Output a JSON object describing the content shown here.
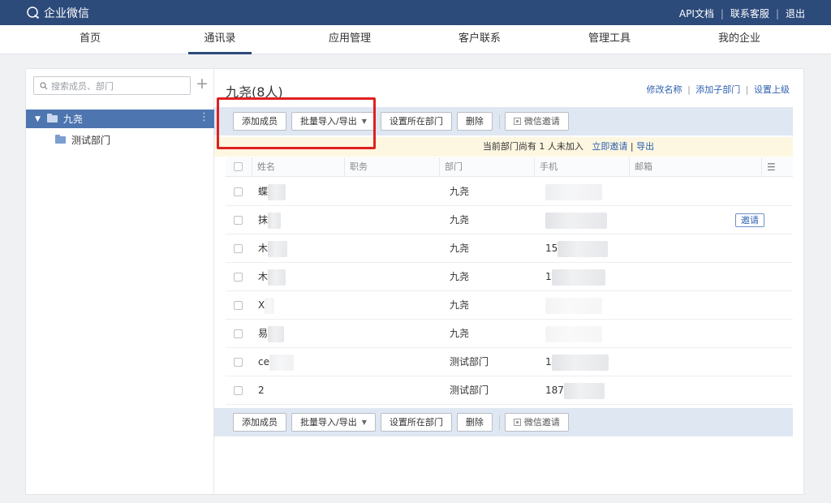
{
  "topbar": {
    "brand": "企业微信",
    "links": [
      "API文档",
      "联系客服",
      "退出"
    ],
    "separator": "|"
  },
  "nav": {
    "items": [
      "首页",
      "通讯录",
      "应用管理",
      "客户联系",
      "管理工具",
      "我的企业"
    ],
    "active_index": 1
  },
  "sidebar": {
    "search_placeholder": "搜索成员、部门",
    "add_icon": "plus-icon",
    "tree": {
      "root_label": "九尧",
      "menu_icon": "⋮",
      "children": [
        "测试部门"
      ]
    }
  },
  "main": {
    "title": "九尧(8人)",
    "header_links": [
      "修改名称",
      "添加子部门",
      "设置上级"
    ],
    "link_sep": "|",
    "toolbar": {
      "add_member": "添加成员",
      "batch": "批量导入/导出",
      "set_dept": "设置所在部门",
      "delete": "删除",
      "wechat_invite": "微信邀请"
    },
    "notice": {
      "text": "当前部门尚有 1 人未加入",
      "link_invite": "立即邀请",
      "sep": "|",
      "link_export": "导出"
    },
    "columns": [
      "姓名",
      "职务",
      "部门",
      "手机",
      "邮箱"
    ],
    "columns_menu_icon": "☰",
    "invite_label": "邀请",
    "rows": [
      {
        "name": "蝶",
        "dept": "九尧",
        "phone": ""
      },
      {
        "name": "抹",
        "dept": "九尧",
        "phone": ""
      },
      {
        "name": "木",
        "dept": "九尧",
        "phone": "15"
      },
      {
        "name": "木",
        "dept": "九尧",
        "phone": "1"
      },
      {
        "name": "X",
        "dept": "九尧",
        "phone": ""
      },
      {
        "name": "易",
        "dept": "九尧",
        "phone": ""
      },
      {
        "name": "ce",
        "dept": "测试部门",
        "phone": "1"
      },
      {
        "name": "2",
        "dept": "测试部门",
        "phone": "187"
      }
    ]
  },
  "colors": {
    "topbar_bg": "#2c4a7a",
    "accent": "#4d75b0",
    "link": "#2f62b0",
    "highlight_box": "#e02020"
  }
}
